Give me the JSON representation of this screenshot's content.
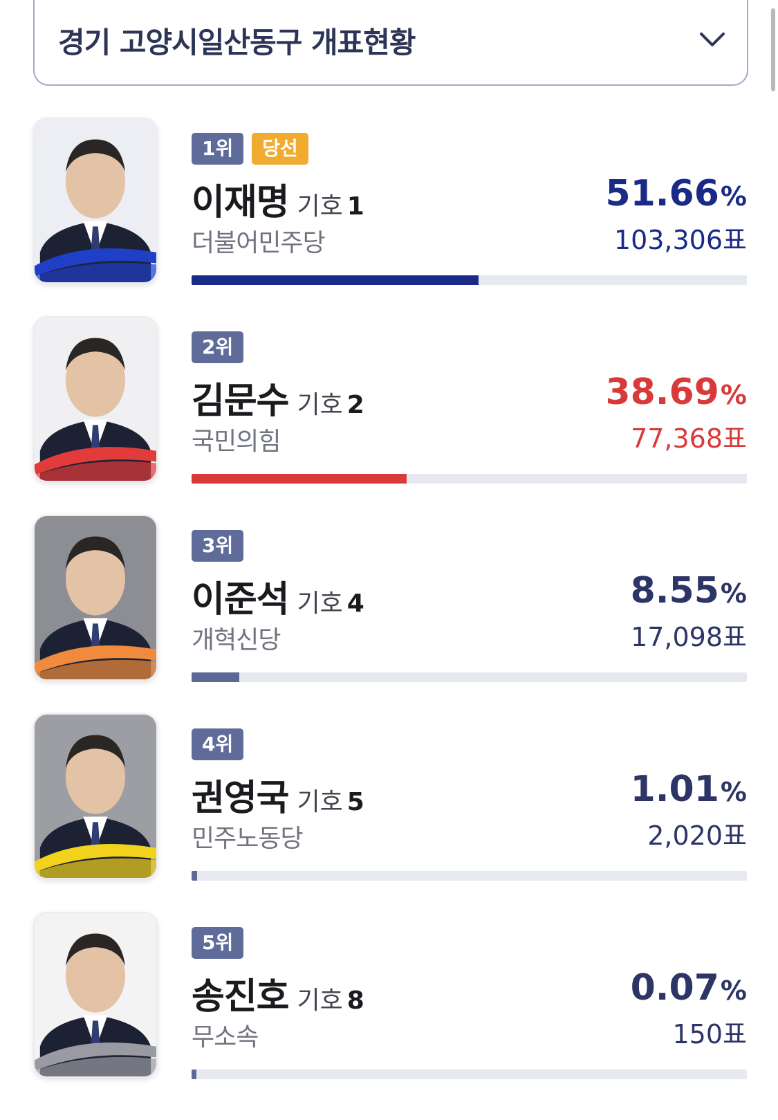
{
  "header": {
    "title": "경기 고양시일산동구 개표현황",
    "dropdown_icon": "chevron-down-icon"
  },
  "candidates": [
    {
      "rank": "1위",
      "winner_badge": "당선",
      "name": "이재명",
      "number_label": "기호",
      "number": "1",
      "party": "더불어민주당",
      "percent": "51.66",
      "percent_unit": "%",
      "votes": "103,306표",
      "share": 51.66,
      "color": "#1a2a87",
      "accent": "#1f3fc7"
    },
    {
      "rank": "2위",
      "name": "김문수",
      "number_label": "기호",
      "number": "2",
      "party": "국민의힘",
      "percent": "38.69",
      "percent_unit": "%",
      "votes": "77,368표",
      "share": 38.69,
      "color": "#d83a3a",
      "accent": "#e23b3b"
    },
    {
      "rank": "3위",
      "name": "이준석",
      "number_label": "기호",
      "number": "4",
      "party": "개혁신당",
      "percent": "8.55",
      "percent_unit": "%",
      "votes": "17,098표",
      "share": 8.55,
      "color": "#2c3566",
      "bar_color": "#5d6895",
      "accent": "#f08a3c"
    },
    {
      "rank": "4위",
      "name": "권영국",
      "number_label": "기호",
      "number": "5",
      "party": "민주노동당",
      "percent": "1.01",
      "percent_unit": "%",
      "votes": "2,020표",
      "share": 1.01,
      "color": "#2c3566",
      "bar_color": "#5d6895",
      "accent": "#f2d21c"
    },
    {
      "rank": "5위",
      "name": "송진호",
      "number_label": "기호",
      "number": "8",
      "party": "무소속",
      "percent": "0.07",
      "percent_unit": "%",
      "votes": "150표",
      "share": 0.07,
      "color": "#2c3566",
      "bar_color": "#5d6895",
      "accent": "#9a9aa2"
    }
  ]
}
